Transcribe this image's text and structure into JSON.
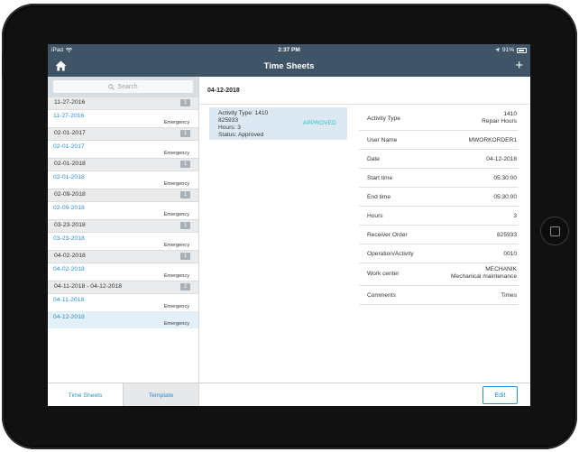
{
  "status_bar": {
    "carrier": "iPad",
    "time": "2:37 PM",
    "battery": "91%"
  },
  "nav": {
    "title": "Time Sheets",
    "home_icon": "home-icon",
    "add_icon": "plus-icon"
  },
  "search": {
    "placeholder": "Search"
  },
  "list": [
    {
      "type": "section",
      "label": "11-27-2016",
      "count": "1"
    },
    {
      "type": "item",
      "date": "11-27-2016",
      "sub": "Emergency"
    },
    {
      "type": "section",
      "label": "02-01-2017",
      "count": "1"
    },
    {
      "type": "item",
      "date": "02-01-2017",
      "sub": "Emergency"
    },
    {
      "type": "section",
      "label": "02-01-2018",
      "count": "1"
    },
    {
      "type": "item",
      "date": "02-01-2018",
      "sub": "Emergency"
    },
    {
      "type": "section",
      "label": "02-09-2018",
      "count": "1"
    },
    {
      "type": "item",
      "date": "02-09-2018",
      "sub": "Emergency"
    },
    {
      "type": "section",
      "label": "03-23-2018",
      "count": "1"
    },
    {
      "type": "item",
      "date": "03-23-2018",
      "sub": "Emergency"
    },
    {
      "type": "section",
      "label": "04-02-2018",
      "count": "1"
    },
    {
      "type": "item",
      "date": "04-02-2018",
      "sub": "Emergency"
    },
    {
      "type": "section",
      "label": "04-11-2018 - 04-12-2018",
      "count": "2"
    },
    {
      "type": "item",
      "date": "04-11-2018",
      "sub": "Emergency"
    },
    {
      "type": "item",
      "date": "04-12-2018",
      "sub": "Emergency",
      "selected": true
    }
  ],
  "tabs": {
    "time_sheets": "Time Sheets",
    "template": "Template"
  },
  "detail": {
    "header_date": "04-12-2018",
    "card": {
      "activity_type": "Activity Type: 1410",
      "order": "825933",
      "hours": "Hours: 3",
      "status": "Status: Approved",
      "badge": "APPROVED"
    },
    "properties": [
      {
        "label": "Activity Type",
        "value": "1410",
        "value2": "Repair Hours"
      },
      {
        "label": "User Name",
        "value": "MWORKORDER1"
      },
      {
        "label": "Date",
        "value": "04-12-2018"
      },
      {
        "label": "Start time",
        "value": "05:30:00"
      },
      {
        "label": "End time",
        "value": "05:30:00"
      },
      {
        "label": "Hours",
        "value": "3"
      },
      {
        "label": "Receiver Order",
        "value": "825933"
      },
      {
        "label": "Operation/Activity",
        "value": "0010"
      },
      {
        "label": "Work center",
        "value": "MECHANIK",
        "value2": "Mechanical maintenance"
      },
      {
        "label": "Comments",
        "value": "Times"
      }
    ],
    "edit_label": "Edit"
  },
  "colors": {
    "header": "#3f5466",
    "accent": "#2a8fd3",
    "approved": "#1fc2c4",
    "selected_row": "#e4f0f8"
  }
}
